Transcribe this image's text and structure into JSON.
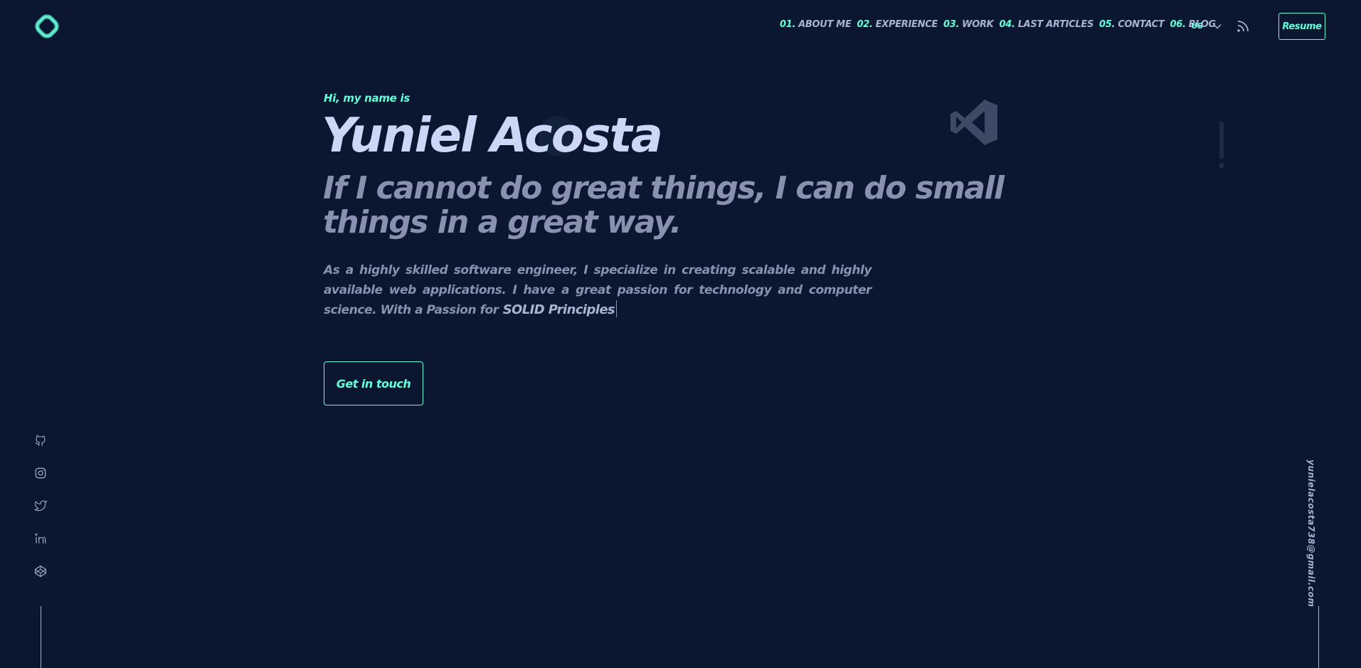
{
  "header": {
    "nav": [
      {
        "num": "01.",
        "label": "ABOUT ME"
      },
      {
        "num": "02.",
        "label": "EXPERIENCE"
      },
      {
        "num": "03.",
        "label": "WORK"
      },
      {
        "num": "04.",
        "label": "LAST ARTICLES"
      },
      {
        "num": "05.",
        "label": "CONTACT"
      },
      {
        "num": "06.",
        "label": "BLOG"
      }
    ],
    "language": "US",
    "resume_label": "Resume"
  },
  "hero": {
    "greeting": "Hi, my name is",
    "name": "Yuniel Acosta",
    "tagline": "If I cannot do great things, I can do small things in a great way.",
    "about": "As a highly skilled software engineer, I specialize in creating scalable and highly available web applications. I have a great passion for technology and computer science. With a Passion for",
    "about_highlight": "SOLID Principles",
    "cta_label": "Get in touch"
  },
  "social": {
    "icons": [
      "github-icon",
      "instagram-icon",
      "twitter-icon",
      "linkedin-icon",
      "codepen-icon"
    ]
  },
  "email": "yunielacosta738@gmail.com",
  "colors": {
    "background": "#0b1730",
    "accent": "#64ffda",
    "heading": "#ccd6f6",
    "text": "#8892b0",
    "light_text": "#a8b2d1"
  }
}
